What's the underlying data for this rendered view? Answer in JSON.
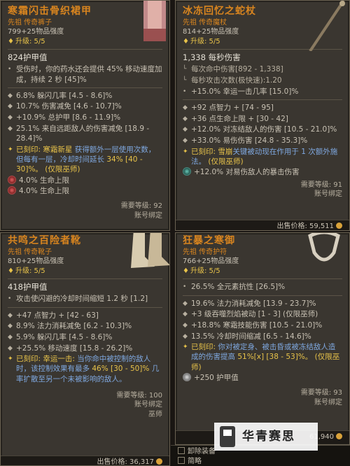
{
  "cards": [
    {
      "title": "寒霜闪击骨织裙甲",
      "type": "先祖 传奇裤子",
      "power": "799+25物品强度",
      "upgrade": "升级: 5/5",
      "main_stat": "824护甲值",
      "inherent": "受伤时，你的药水还会提供 45% 移动速度加成，持续 2 秒 [45]%",
      "affixes": [
        "6.8% 躲闪几率 [4.5 - 8.6]%",
        "10.7% 伤害减免 [4.6 - 10.7]%",
        "+10.9% 总护甲 [8.6 - 11.9]%",
        "25.1% 来自远距敌人的伤害减免 [18.9 - 28.4]%"
      ],
      "aspect_label": "已刻印:",
      "aspect_title": "寒霜新星",
      "aspect_highlight": "获得额外一层使用次数，但每有一层，冷却时间延长",
      "aspect_value": "34% [40 - 30]%。",
      "aspect_class": "(仅限巫师)",
      "sockets": [
        "4.0% 生命上限",
        "4.0% 生命上限"
      ],
      "req_level": "需要等级: 92",
      "bound": "账号绑定"
    },
    {
      "title": "冰冻回忆之蛇杖",
      "type": "先祖 传奇魔杖",
      "power": "814+25物品强度",
      "upgrade": "升级: 5/5",
      "main_stat": "1,338 每秒伤害",
      "weapon_lines": [
        "每次命中伤害[892 - 1,338]",
        "每秒攻击次数(极快速):1.20"
      ],
      "inherent": "+15.0% 幸运一击几率 [15.0]%",
      "affixes": [
        "+92 点智力 + [74 - 95]",
        "+36 点生命上限 + [30 - 42]",
        "+12.0% 对冻结敌人的伤害 [10.5 - 21.0]%",
        "+33.0% 易伤伤害 [24.8 - 35.3]%"
      ],
      "aspect_label": "已刻印:",
      "aspect_title": "雪崩",
      "aspect_highlight": "关键被动现在作用于 1 次额外施法。",
      "aspect_class": "(仅限巫师)",
      "sockets": [
        "+12.0% 对易伤敌人的暴击伤害"
      ],
      "req_level": "需要等级: 91",
      "bound": "账号绑定",
      "price": "出售价格: 59,511"
    },
    {
      "title": "共鸣之百险者靴",
      "type": "先祖 传奇靴子",
      "power": "810+25物品强度",
      "upgrade": "升级: 5/5",
      "main_stat": "418护甲值",
      "inherent": "攻击使闪避的冷却时间缩短 1.2 秒 [1.2]",
      "affixes": [
        "+47 点智力 + [42 - 63]",
        "8.9% 法力消耗减免 [6.2 - 10.3]%",
        "5.9% 躲闪几率 [4.5 - 8.6]%",
        "+25.5% 移动速度 [15.8 - 26.2]%"
      ],
      "aspect_label": "已刻印:",
      "aspect_title": "幸运一击:",
      "aspect_highlight": "当你命中被控制的敌人时，该控制效果有最多",
      "aspect_value": "46% [30 - 50]%",
      "aspect_tail": "几率扩散至另一个未被影响的敌人。",
      "req_level": "需要等级: 100",
      "bound": "账号绑定",
      "class_req": "巫师",
      "price": "出售价格: 36,317"
    },
    {
      "title": "狂暴之寒御",
      "type": "先祖 传奇护符",
      "power": "766+25物品强度",
      "upgrade": "升级: 5/5",
      "inherent": "26.5% 全元素抗性 [26.5]%",
      "affixes": [
        "19.6% 法力消耗减免 [13.9 - 23.7]%",
        "+3 级吞噬烈焰被动 [1 - 3] (仅限巫师)",
        "+18.8% 寒霜技能伤害 [10.5 - 21.0]%",
        "13.5% 冷却时间缩减 [6.5 - 14.6]%"
      ],
      "aspect_label": "已刻印:",
      "aspect_highlight": "你对被定身、被击昏或被冻结敌人造成的伤害提高",
      "aspect_value": "51%[x] [38 - 53]%。",
      "aspect_class": "(仅限巫师)",
      "sockets": [
        "+250 护甲值"
      ],
      "req_level": "需要等级: 93",
      "bound": "账号绑定",
      "price_partial": "61,940"
    }
  ],
  "bottom": {
    "unequip": "卸除装备",
    "compare": "简略"
  },
  "watermark": "华青赛思"
}
